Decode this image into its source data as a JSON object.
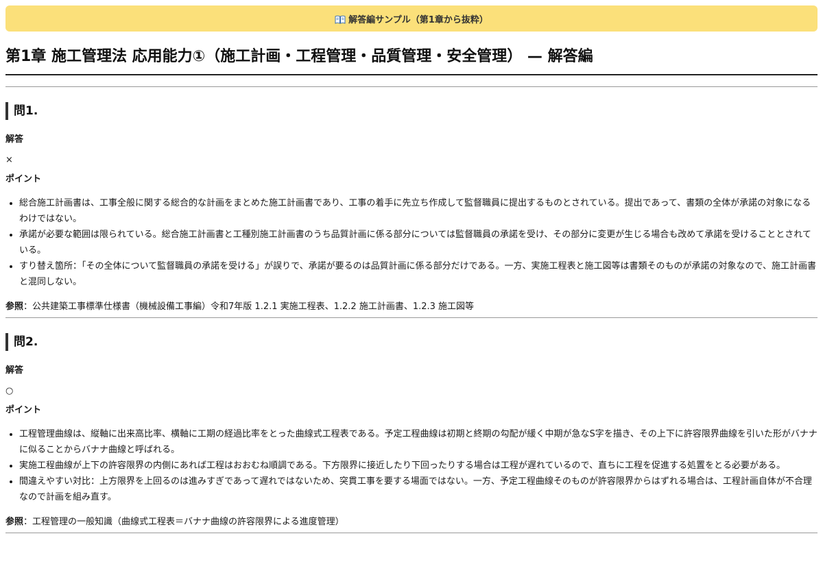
{
  "banner": {
    "icon": "open-book-icon",
    "text": "解答編サンプル（第1章から抜粋）",
    "color": "#fbe07a"
  },
  "chapter": {
    "title": "第1章 施工管理法 応用能力①（施工計画・工程管理・品質管理・安全管理） — 解答編"
  },
  "questions": [
    {
      "heading": "問1.",
      "answer_label": "解答",
      "answer": "×",
      "point_label": "ポイント",
      "points": [
        "総合施工計画書は、工事全般に関する総合的な計画をまとめた施工計画書であり、工事の着手に先立ち作成して監督職員に提出するものとされている。提出であって、書類の全体が承諾の対象になるわけではない。",
        "承諾が必要な範囲は限られている。総合施工計画書と工種別施工計画書のうち品質計画に係る部分については監督職員の承諾を受け、その部分に変更が生じる場合も改めて承諾を受けることとされている。",
        "すり替え箇所：「その全体について監督職員の承諾を受ける」が誤りで、承諾が要るのは品質計画に係る部分だけである。一方、実施工程表と施工図等は書類そのものが承諾の対象なので、施工計画書と混同しない。"
      ],
      "ref_label": "参照",
      "ref_text": "：公共建築工事標準仕様書（機械設備工事編）令和7年版 1.2.1 実施工程表、1.2.2 施工計画書、1.2.3 施工図等"
    },
    {
      "heading": "問2.",
      "answer_label": "解答",
      "answer": "○",
      "point_label": "ポイント",
      "points": [
        "工程管理曲線は、縦軸に出来高比率、横軸に工期の経過比率をとった曲線式工程表である。予定工程曲線は初期と終期の勾配が緩く中期が急なS字を描き、その上下に許容限界曲線を引いた形がバナナに似ることからバナナ曲線と呼ばれる。",
        "実施工程曲線が上下の許容限界の内側にあれば工程はおおむね順調である。下方限界に接近したり下回ったりする場合は工程が遅れているので、直ちに工程を促進する処置をとる必要がある。",
        "間違えやすい対比：上方限界を上回るのは進みすぎであって遅れではないため、突貫工事を要する場面ではない。一方、予定工程曲線そのものが許容限界からはずれる場合は、工程計画自体が不合理なので計画を組み直す。"
      ],
      "ref_label": "参照",
      "ref_text": "：工程管理の一般知識（曲線式工程表＝バナナ曲線の許容限界による進度管理）"
    }
  ]
}
